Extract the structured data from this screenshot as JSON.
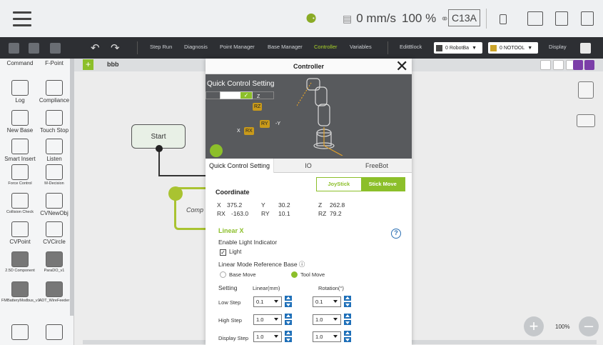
{
  "status_bar": {
    "speed_value": "0 mm/s",
    "speed_percent": "100 %",
    "mode_badge": "C13A"
  },
  "toolbar": {
    "items": [
      "Step Run",
      "Diagnosis",
      "Point Manager",
      "Base Manager",
      "Controller",
      "Variables",
      "EditBlock"
    ],
    "active_item": "Controller",
    "robot_base_select": "0 RobotBa",
    "tool_select": "0 NOTOOL",
    "display_label": "Display"
  },
  "palette": {
    "items": [
      "Command",
      "F-Point",
      "Log",
      "Compliance",
      "New Base",
      "Touch Stop",
      "Smart Insert",
      "Listen",
      "Force Control",
      "M-Decision",
      "Collision Check",
      "CVNewObj",
      "CVPoint",
      "CVCircle",
      "2.5D Component",
      "ParaDO_v1",
      "FMBatteryModbus_v1",
      "ADT_WireFeeder"
    ]
  },
  "canvas": {
    "tab_name": "bbb",
    "start_label": "Start",
    "component_label": "Comp",
    "zoom_level": "100%"
  },
  "dialog": {
    "title": "Controller",
    "preview_label": "Quick Control Setting",
    "axis_badges": {
      "rz": "RZ",
      "ry": "RY",
      "rx": "RX"
    },
    "axis_letters": {
      "z": "Z",
      "y": "-Y",
      "x": "X"
    },
    "tabs": [
      "Quick Control Setting",
      "IO",
      "FreeBot"
    ],
    "active_tab": "Quick Control Setting",
    "mode_tabs": {
      "joystick": "JoyStick",
      "stick_move": "Stick Move",
      "active": "Stick Move"
    },
    "coordinate": {
      "title": "Coordinate",
      "x_label": "X",
      "x": "375.2",
      "y_label": "Y",
      "y": "30.2",
      "z_label": "Z",
      "z": "262.8",
      "rx_label": "RX",
      "rx": "-163.0",
      "ry_label": "RY",
      "ry": "10.1",
      "rz_label": "RZ",
      "rz": "79.2"
    },
    "linear": {
      "title": "Linear X",
      "light_indicator_label": "Enable Light Indicator",
      "light_checkbox_label": "Light",
      "light_checked": true,
      "ref_base_label": "Linear Mode Reference Base ⓘ",
      "base_move_label": "Base Move",
      "tool_move_label": "Tool Move",
      "selected_ref": "Tool Move",
      "setting_header": "Setting",
      "linear_header": "Linear(mm)",
      "rotation_header": "Rotation(°)",
      "rows": [
        {
          "label": "Low Step",
          "linear": "0.1",
          "rotation": "0.1"
        },
        {
          "label": "High Step",
          "linear": "1.0",
          "rotation": "1.0"
        },
        {
          "label": "Display Step",
          "linear": "1.0",
          "rotation": "1.0"
        }
      ]
    }
  },
  "colors": {
    "accent": "#8cbf2a",
    "toolbar_bg": "#2d2f33",
    "stepper": "#1e6fb8"
  }
}
